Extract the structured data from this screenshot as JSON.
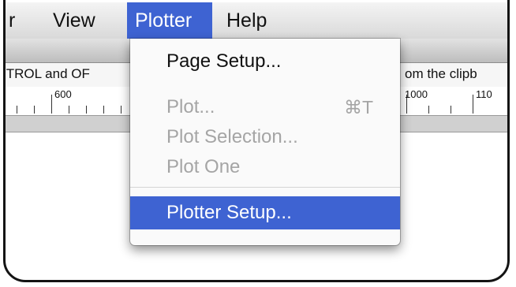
{
  "menubar": {
    "items": [
      {
        "label": "r"
      },
      {
        "label": "View"
      },
      {
        "label": "Plotter"
      },
      {
        "label": "Help"
      }
    ]
  },
  "hint": {
    "left": "ITROL and OF",
    "right": "om the clipb"
  },
  "ruler": {
    "labels": [
      "600",
      "1000",
      "110"
    ]
  },
  "plotter_menu": {
    "page_setup": "Page Setup...",
    "plot": "Plot...",
    "plot_shortcut": "⌘T",
    "plot_selection": "Plot Selection...",
    "plot_one": "Plot One",
    "plotter_setup": "Plotter Setup..."
  },
  "colors": {
    "highlight": "#3e63d2"
  }
}
